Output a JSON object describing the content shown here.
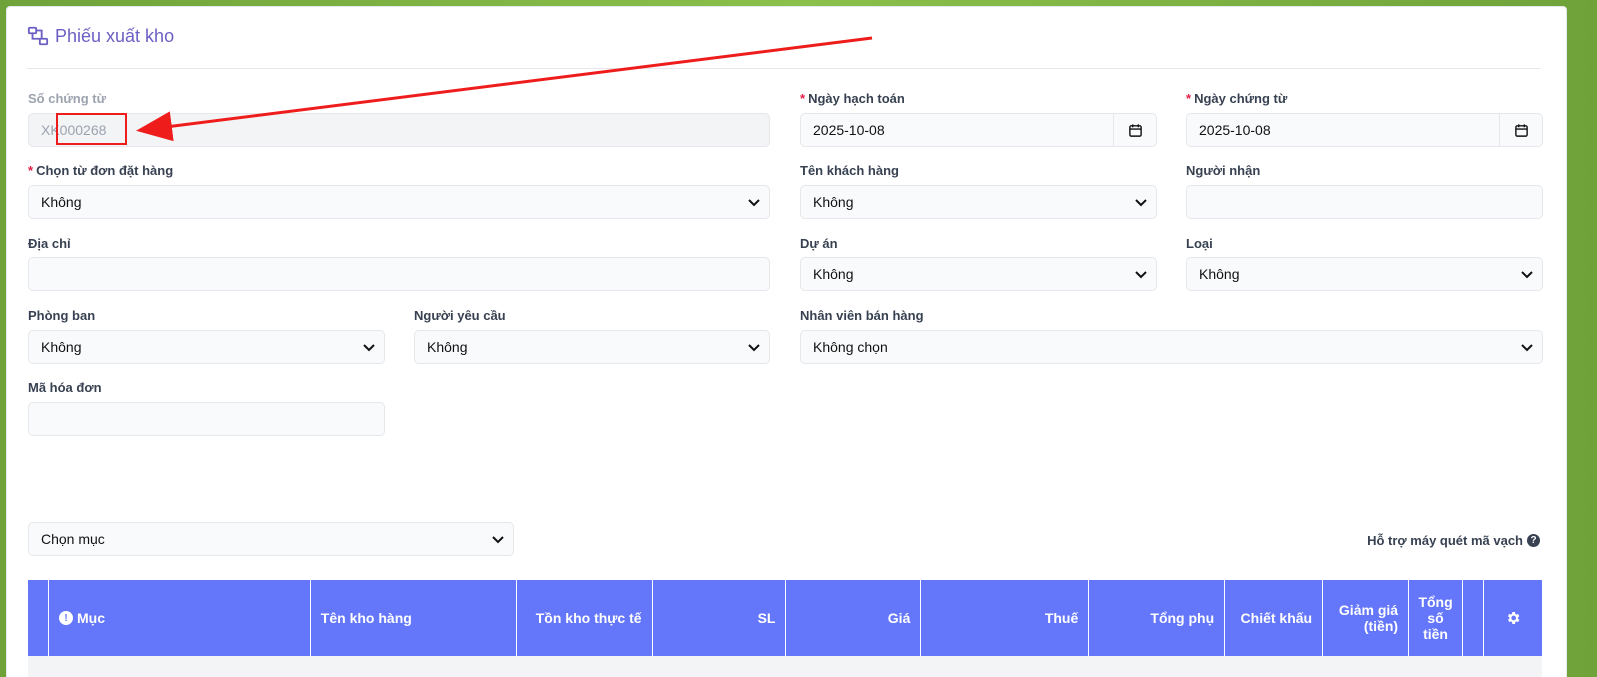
{
  "header": {
    "title": "Phiếu xuất kho",
    "icon": "flow-icon"
  },
  "form": {
    "voucher_no": {
      "label": "Số chứng từ",
      "value": "XK000268"
    },
    "posting_date": {
      "label": "Ngày hạch toán",
      "value": "2025-10-08"
    },
    "voucher_date": {
      "label": "Ngày chứng từ",
      "value": "2025-10-08"
    },
    "from_order": {
      "label": "Chọn từ đơn đặt hàng",
      "value": "Không"
    },
    "customer": {
      "label": "Tên khách hàng",
      "value": "Không"
    },
    "receiver": {
      "label": "Người nhận",
      "value": ""
    },
    "address": {
      "label": "Địa chỉ",
      "value": ""
    },
    "project": {
      "label": "Dự án",
      "value": "Không"
    },
    "type": {
      "label": "Loại",
      "value": "Không"
    },
    "department": {
      "label": "Phòng ban",
      "value": "Không"
    },
    "requester": {
      "label": "Người yêu cầu",
      "value": "Không"
    },
    "sales_staff": {
      "label": "Nhân viên bán hàng",
      "value": "Không chọn"
    },
    "invoice_code": {
      "label": "Mã hóa đơn",
      "value": ""
    },
    "required_mark": "*"
  },
  "items_select": {
    "value": "Chọn mục"
  },
  "barcode": {
    "label": "Hỗ trợ máy quét mã vạch",
    "help": "?"
  },
  "table": {
    "info_glyph": "!",
    "columns": [
      {
        "key": "item",
        "label": "Mục"
      },
      {
        "key": "warehouse",
        "label": "Tên kho hàng"
      },
      {
        "key": "stock",
        "label": "Tồn kho thực tế"
      },
      {
        "key": "qty",
        "label": "SL"
      },
      {
        "key": "price",
        "label": "Giá"
      },
      {
        "key": "tax",
        "label": "Thuế"
      },
      {
        "key": "subtotal",
        "label": "Tổng phụ"
      },
      {
        "key": "discount",
        "label": "Chiết khấu"
      },
      {
        "key": "discount_amount",
        "label": "Giảm giá (tiền)"
      },
      {
        "key": "total",
        "label": "Tổng số tiền"
      }
    ]
  },
  "colors": {
    "accent": "#6477fb",
    "title": "#6b5fc4",
    "annotation": "#ef1c1c"
  }
}
